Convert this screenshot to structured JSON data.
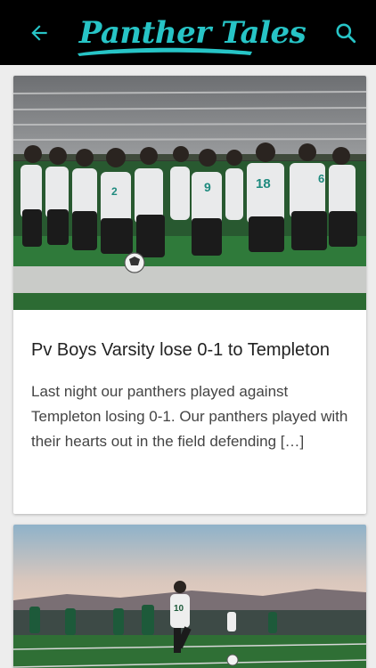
{
  "app": {
    "title": "Panther Tales",
    "accent_color": "#27c4c6",
    "back_icon": "arrow-left-icon",
    "search_icon": "search-icon"
  },
  "posts": [
    {
      "title": "Pv Boys Varsity lose 0-1 to Templeton",
      "excerpt": "Last night our panthers played against Templeton losing 0-1. Our panthers played with their hearts out in the field defending […]",
      "image": "team-huddle-photo"
    },
    {
      "title": "",
      "excerpt": "",
      "image": "soccer-match-photo"
    }
  ]
}
